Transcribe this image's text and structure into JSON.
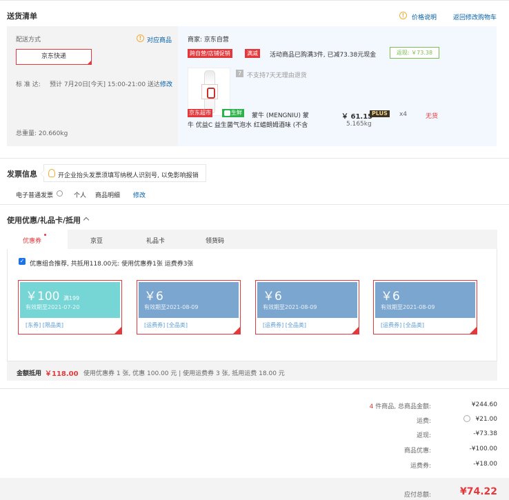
{
  "delivery": {
    "title": "送货清单",
    "price_note": "价格说明",
    "back_to_cart": "返回修改购物车",
    "method_label": "配送方式",
    "matching_items": "对应商品",
    "express_option": "京东快递",
    "standard_label": "标 准 达:",
    "standard_time": "预计 7月20日[今天] 15:00-21:00 送达",
    "modify": "修改",
    "total_weight": "总重量: 20.660kg"
  },
  "shop": {
    "merchant": "商家: 京东自营",
    "tag_promo": "跨自营/店铺促销",
    "tag_discount": "满减",
    "promo_text": "活动商品已购满3件, 已减73.38元现金",
    "rebate": "返现: ￥73.38",
    "no_return": "不支持7天无理由退货",
    "tag_jdcs": "京东超市",
    "tag_fresh": "生鲜",
    "product_name_line1": "蒙牛 (MENGNIU) 蒙",
    "product_name_line2": "牛 优益C 益生菌气泡水 红蜡朗姆酒味 (不含",
    "price": "￥ 61.15",
    "plus": "PLUS",
    "weight": "5.165kg",
    "qty": "x4",
    "stock": "无货"
  },
  "invoice": {
    "title": "发票信息",
    "tip": "开企业抬头发票须填写纳税人识别号, 以免影响报销",
    "type": "电子普通发票",
    "holder": "个人",
    "detail": "商品明细",
    "modify": "修改"
  },
  "discount": {
    "title": "使用优惠/礼品卡/抵用",
    "tabs": [
      "优惠券",
      "京豆",
      "礼品卡",
      "领货码"
    ],
    "recommend": "优惠组合推荐, 共抵用118.00元: 使用优惠券1张 运费券3张",
    "coupons": [
      {
        "amount": "￥100",
        "cond": "满199",
        "valid": "有效期至2021-07-20",
        "cat": "[东券]  [限品类]",
        "color": "#76d5d5"
      },
      {
        "amount": "￥6",
        "cond": "",
        "valid": "有效期至2021-08-09",
        "cat": "[运费券]  [全品类]",
        "color": "#7ba6cf"
      },
      {
        "amount": "￥6",
        "cond": "",
        "valid": "有效期至2021-08-09",
        "cat": "[运费券]  [全品类]",
        "color": "#7ba6cf"
      },
      {
        "amount": "￥6",
        "cond": "",
        "valid": "有效期至2021-08-09",
        "cat": "[运费券]  [全品类]",
        "color": "#7ba6cf"
      }
    ],
    "footer_label": "金额抵用",
    "footer_amount": "￥118.00",
    "footer_detail": "使用优惠券 1 张, 优惠 100.00 元  |  使用运费券 3 张, 抵用运费 18.00 元"
  },
  "summary": {
    "count_prefix": "4",
    "count_suffix": "件商品, 总商品金额:",
    "total_goods": "¥244.60",
    "freight_label": "运费:",
    "freight": "¥21.00",
    "rebate_label": "返现:",
    "rebate": "-¥73.38",
    "goods_discount_label": "商品优惠:",
    "goods_discount": "-¥100.00",
    "freight_coupon_label": "运费券:",
    "freight_coupon": "-¥18.00",
    "payable_label": "应付总额:",
    "payable": "¥74.22"
  }
}
